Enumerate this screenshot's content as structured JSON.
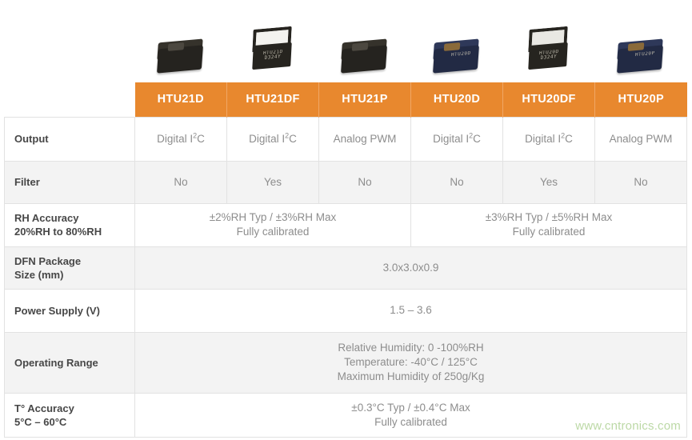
{
  "products": [
    {
      "name": "HTU21D",
      "style": "black",
      "marking": ""
    },
    {
      "name": "HTU21DF",
      "style": "capped",
      "marking": "HTU21D\nD324Y"
    },
    {
      "name": "HTU21P",
      "style": "black",
      "marking": ""
    },
    {
      "name": "HTU20D",
      "style": "navy",
      "marking": "HTU20D"
    },
    {
      "name": "HTU20DF",
      "style": "capped-dark",
      "marking": "HTU20D\nD324Y"
    },
    {
      "name": "HTU20P",
      "style": "navy",
      "marking": "HTU20P"
    }
  ],
  "table": {
    "columns": [
      "HTU21D",
      "HTU21DF",
      "HTU21P",
      "HTU20D",
      "HTU20DF",
      "HTU20P"
    ],
    "rows": [
      {
        "label": "Output",
        "cells": [
          "Digital I2C",
          "Digital I2C",
          "Analog PWM",
          "Digital I2C",
          "Digital I2C",
          "Analog PWM"
        ]
      },
      {
        "label": "Filter",
        "cells": [
          "No",
          "Yes",
          "No",
          "No",
          "Yes",
          "No"
        ]
      },
      {
        "label": "RH Accuracy\n20%RH to 80%RH",
        "label_line1": "RH Accuracy",
        "label_line2": "20%RH to 80%RH",
        "merged": [
          {
            "span": 3,
            "line1": "±2%RH Typ / ±3%RH Max",
            "line2": "Fully calibrated"
          },
          {
            "span": 3,
            "line1": "±3%RH Typ / ±5%RH Max",
            "line2": "Fully calibrated"
          }
        ]
      },
      {
        "label_line1": "DFN Package",
        "label_line2": "Size (mm)",
        "merged": [
          {
            "span": 6,
            "line1": "3.0x3.0x0.9",
            "line2": ""
          }
        ]
      },
      {
        "label_line1": "Power Supply (V)",
        "label_line2": "",
        "merged": [
          {
            "span": 6,
            "line1": "1.5 – 3.6",
            "line2": ""
          }
        ]
      },
      {
        "label_line1": "Operating Range",
        "label_line2": "",
        "merged": [
          {
            "span": 6,
            "line1": "Relative Humidity: 0 -100%RH",
            "line2": "Temperature: -40°C / 125°C",
            "line3": "Maximum Humidity of 250g/Kg"
          }
        ]
      },
      {
        "label_line1": "T° Accuracy",
        "label_line2": "5°C – 60°C",
        "merged": [
          {
            "span": 6,
            "line1": "±0.3°C Typ / ±0.4°C Max",
            "line2": "Fully calibrated"
          }
        ]
      }
    ]
  },
  "watermark": "www.cntronics.com",
  "colors": {
    "header_orange": "#E8882E",
    "row_gray": "#f3f3f3",
    "border": "#e2e2e2",
    "label_text": "#474747",
    "value_text": "#8d8d8d",
    "watermark": "#bcd9a6"
  }
}
